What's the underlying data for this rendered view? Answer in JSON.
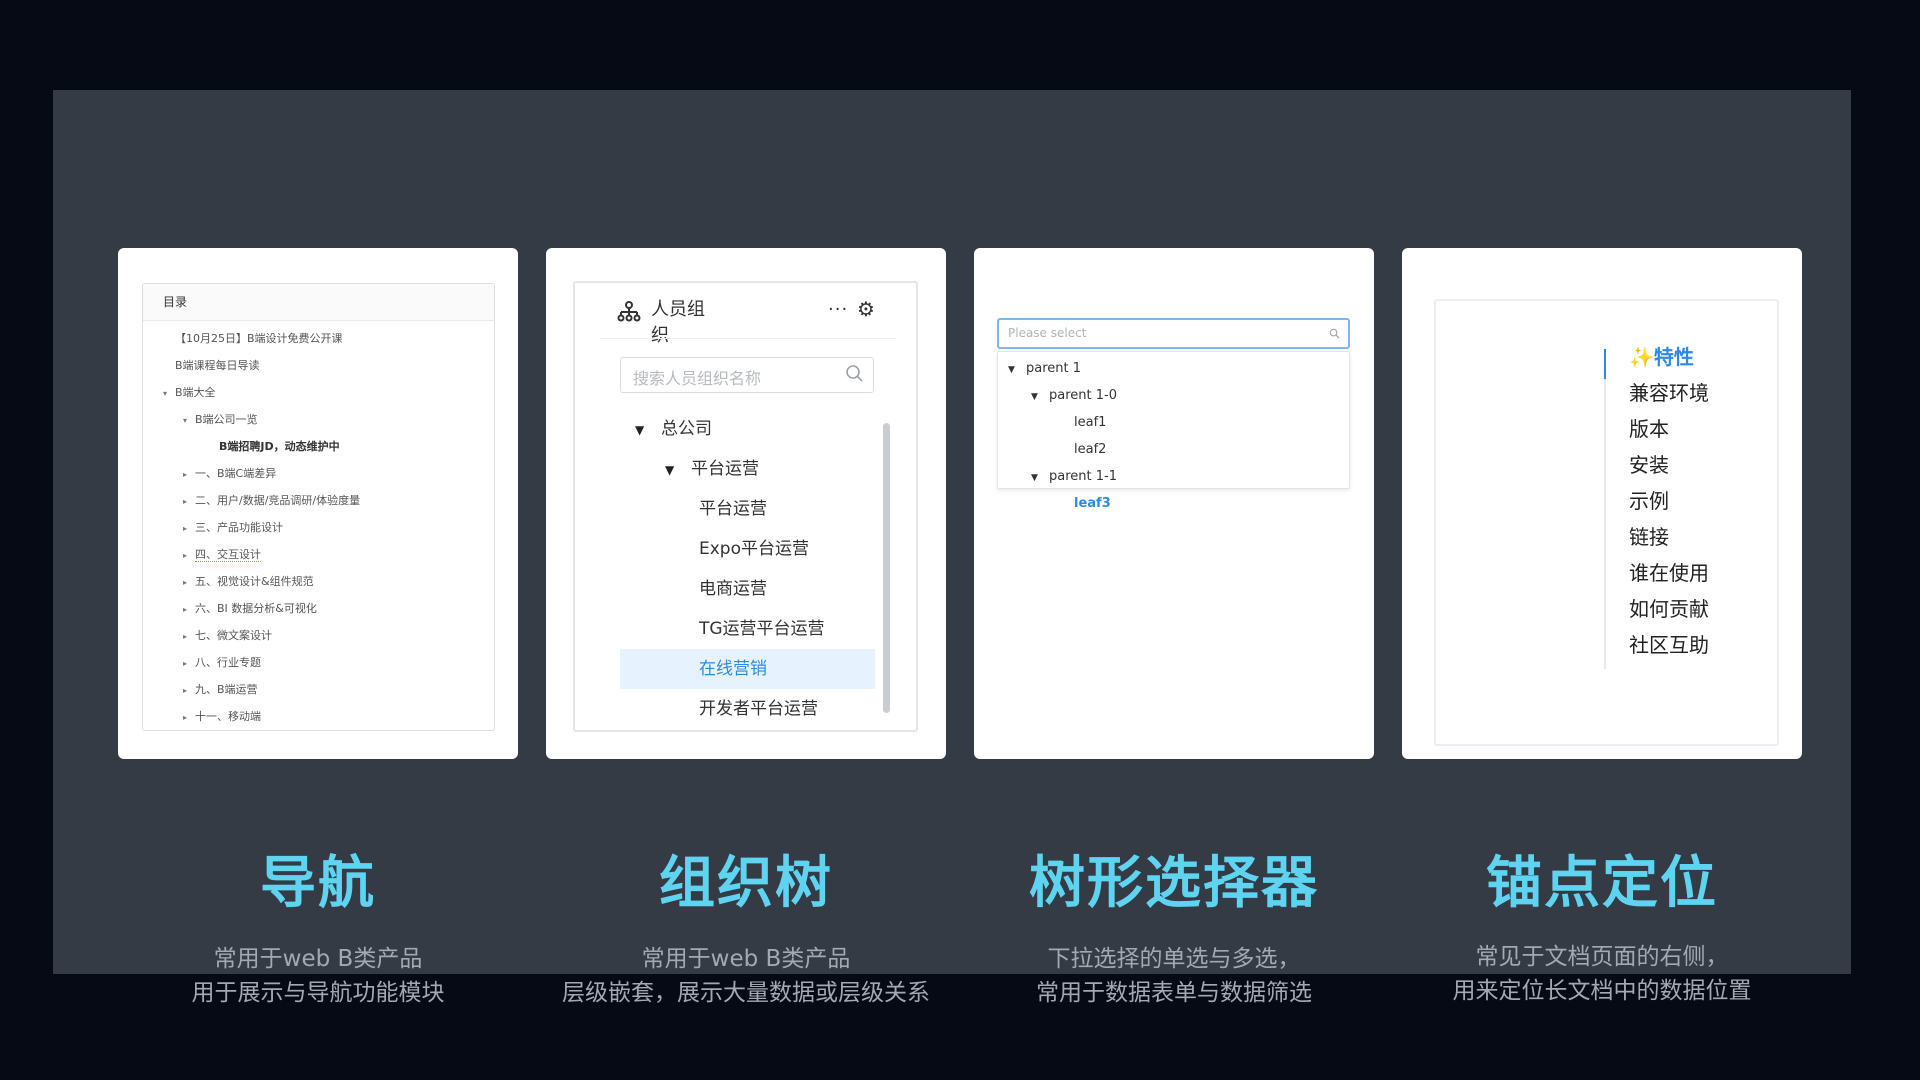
{
  "nav": {
    "header": "目录",
    "items": [
      {
        "label": "【10月25日】B端设计免费公开课",
        "level": 1,
        "arrow": ""
      },
      {
        "label": "B端课程每日导读",
        "level": 1,
        "arrow": ""
      },
      {
        "label": "B端大全",
        "level": 1,
        "arrow": "▾"
      },
      {
        "label": "B端公司一览",
        "level": 2,
        "arrow": "▾"
      },
      {
        "label": "B端招聘JD，动态维护中",
        "level": 3,
        "arrow": ""
      },
      {
        "label": "一、B端C端差异",
        "level": 2,
        "arrow": "▸"
      },
      {
        "label": "二、用户/数据/竞品调研/体验度量",
        "level": 2,
        "arrow": "▸"
      },
      {
        "label": "三、产品功能设计",
        "level": 2,
        "arrow": "▸"
      },
      {
        "label": "四、交互设计",
        "level": 2,
        "arrow": "▸"
      },
      {
        "label": "五、视觉设计&组件规范",
        "level": 2,
        "arrow": "▸"
      },
      {
        "label": "六、BI 数据分析&可视化",
        "level": 2,
        "arrow": "▸"
      },
      {
        "label": "七、微文案设计",
        "level": 2,
        "arrow": "▸"
      },
      {
        "label": "八、行业专题",
        "level": 2,
        "arrow": "▸"
      },
      {
        "label": "九、B端运营",
        "level": 2,
        "arrow": "▸"
      },
      {
        "label": "十一、移动端",
        "level": 2,
        "arrow": "▸"
      }
    ]
  },
  "org": {
    "title": "人员组织",
    "more": "···",
    "gear": "⚙",
    "search_placeholder": "搜索人员组织名称",
    "rows": [
      {
        "label": "总公司",
        "caret": "▼"
      },
      {
        "label": "平台运营",
        "caret": "▼"
      },
      {
        "label": "平台运营",
        "caret": ""
      },
      {
        "label": "Expo平台运营",
        "caret": ""
      },
      {
        "label": "电商运营",
        "caret": ""
      },
      {
        "label": "TG运营平台运营",
        "caret": ""
      },
      {
        "label": "在线营销",
        "caret": ""
      },
      {
        "label": "开发者平台运营",
        "caret": ""
      }
    ]
  },
  "treeselect": {
    "placeholder": "Please select",
    "rows": [
      {
        "label": "parent 1",
        "caret": "▼"
      },
      {
        "label": "parent 1-0",
        "caret": "▼"
      },
      {
        "label": "leaf1",
        "caret": ""
      },
      {
        "label": "leaf2",
        "caret": ""
      },
      {
        "label": "parent 1-1",
        "caret": "▼"
      },
      {
        "label": "leaf3",
        "caret": ""
      }
    ]
  },
  "anchor": {
    "items": [
      "✨特性",
      "兼容环境",
      "版本",
      "安装",
      "示例",
      "链接",
      "谁在使用",
      "如何贡献",
      "社区互助"
    ]
  },
  "captions": [
    {
      "title": "导航",
      "line1": "常用于web B类产品",
      "line2": "用于展示与导航功能模块"
    },
    {
      "title": "组织树",
      "line1": "常用于web B类产品",
      "line2": "层级嵌套，展示大量数据或层级关系"
    },
    {
      "title": "树形选择器",
      "line1": "下拉选择的单选与多选，",
      "line2": "常用于数据表单与数据筛选"
    },
    {
      "title": "锚点定位",
      "line1": "常见于文档页面的右侧，",
      "line2": "用来定位长文档中的数据位置"
    }
  ],
  "colors": {
    "accent": "#5fd4f1",
    "link": "#2c8ae6",
    "panel": "#353b45",
    "background": "#050a14"
  }
}
